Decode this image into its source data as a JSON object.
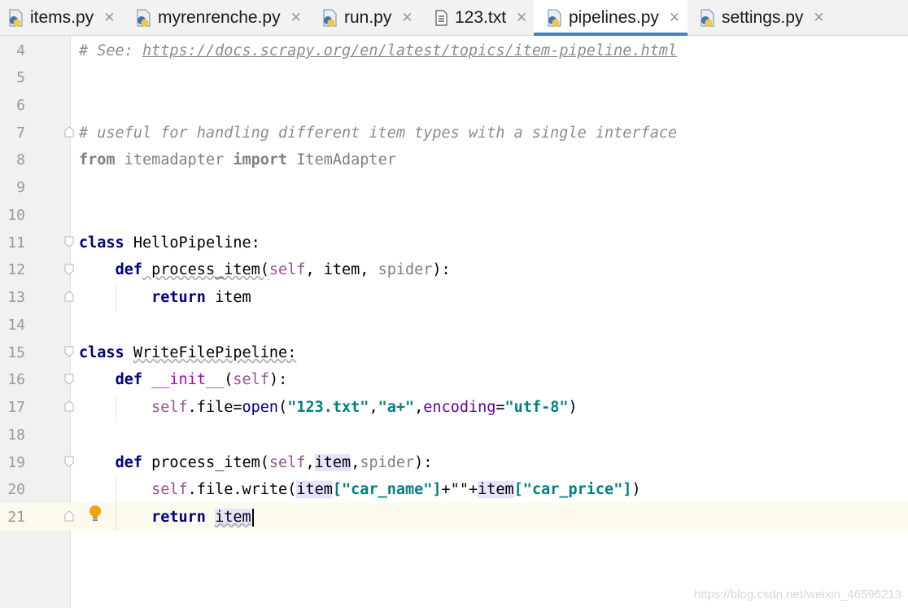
{
  "tabs": [
    {
      "label": "items.py",
      "icon": "python-file-icon",
      "active": false
    },
    {
      "label": "myrenrenche.py",
      "icon": "python-file-icon",
      "active": false
    },
    {
      "label": "run.py",
      "icon": "python-file-icon",
      "active": false
    },
    {
      "label": "123.txt",
      "icon": "text-file-icon",
      "active": false
    },
    {
      "label": "pipelines.py",
      "icon": "python-file-icon",
      "active": true
    },
    {
      "label": "settings.py",
      "icon": "python-file-icon",
      "active": false
    }
  ],
  "close_glyph": "✕",
  "line_numbers": [
    "4",
    "5",
    "6",
    "7",
    "8",
    "9",
    "10",
    "11",
    "12",
    "13",
    "14",
    "15",
    "16",
    "17",
    "18",
    "19",
    "20",
    "21"
  ],
  "code": {
    "l4_comment": "# See: ",
    "l4_link": "https://docs.scrapy.org/en/latest/topics/item-pipeline.html",
    "l7": "# useful for handling different item types with a single interface",
    "l8_from": "from",
    "l8_mod": " itemadapter ",
    "l8_import": "import",
    "l8_name": " ItemAdapter",
    "kw_class": "class",
    "kw_def": "def",
    "kw_return": "return",
    "l11_name": " HelloPipeline:",
    "l12_a": " process_item(",
    "self": "self",
    "l12_b": ", item, ",
    "spider": "spider",
    "l12_c": "):",
    "item": "item",
    "l15_name": "WriteFilePipeline:",
    "l16_init": "__init__",
    "l16_open": "(",
    "l16_close": "):",
    "l17_a": ".file=",
    "l17_open": "open",
    "l17_b": "(",
    "l17_s1": "\"123.txt\"",
    "comma": ",",
    "l17_s2": "\"a+\"",
    "l17_enc": "encoding",
    "l17_eq": "=",
    "l17_s3": "\"utf-8\"",
    "l17_end": ")",
    "l19_a": " process_item(",
    "l19_close": "):",
    "l20_a": ".file.write(",
    "l20_s1": "[\"car_name\"]",
    "l20_plus": "+\"\"+",
    "l20_s2": "[\"car_price\"]",
    "l20_end": ")"
  },
  "watermark": "https://blog.csdn.net/weixin_46596213",
  "colors": {
    "accent": "#4083c9",
    "keyword": "#000080",
    "string": "#067d17",
    "self": "#94558d",
    "comment": "#8c8c8c"
  }
}
